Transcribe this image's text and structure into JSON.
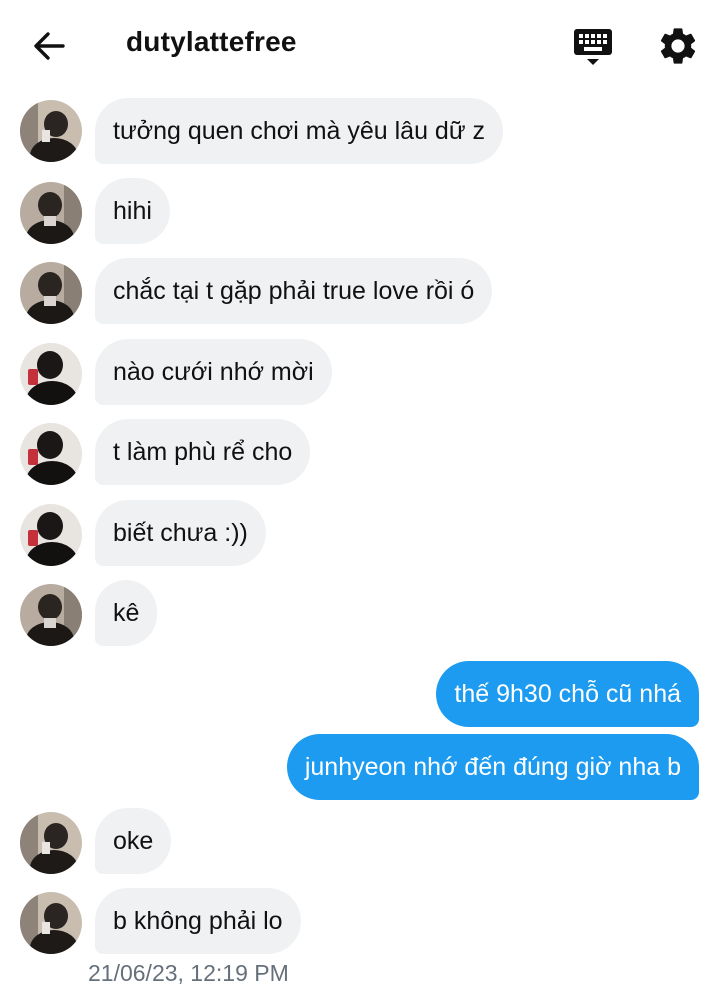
{
  "header": {
    "title": "dutylattefree",
    "back_icon": "arrow-left-icon",
    "keyboard_icon": "keyboard-icon",
    "settings_icon": "gear-icon"
  },
  "colors": {
    "accent": "#1d9bf0",
    "incoming_bubble": "#eff1f3",
    "timestamp": "#66707a"
  },
  "messages": [
    {
      "text": "tưởng quen chơi mà yêu lâu dữ z",
      "from": "them"
    },
    {
      "text": "hihi",
      "from": "them"
    },
    {
      "text": "chắc tại t gặp phải true love rồi ó",
      "from": "them"
    },
    {
      "text": "nào cưới nhớ mời",
      "from": "them"
    },
    {
      "text": "t làm phù rể cho",
      "from": "them"
    },
    {
      "text": "biết chưa :))",
      "from": "them"
    },
    {
      "text": "kê",
      "from": "them"
    },
    {
      "text": "thế 9h30 chỗ cũ nhá",
      "from": "me"
    },
    {
      "text": "junhyeon nhớ đến đúng giờ nha b",
      "from": "me"
    },
    {
      "text": "oke",
      "from": "them"
    },
    {
      "text": "b không phải lo",
      "from": "them"
    }
  ],
  "timestamp": "21/06/23, 12:19 PM"
}
